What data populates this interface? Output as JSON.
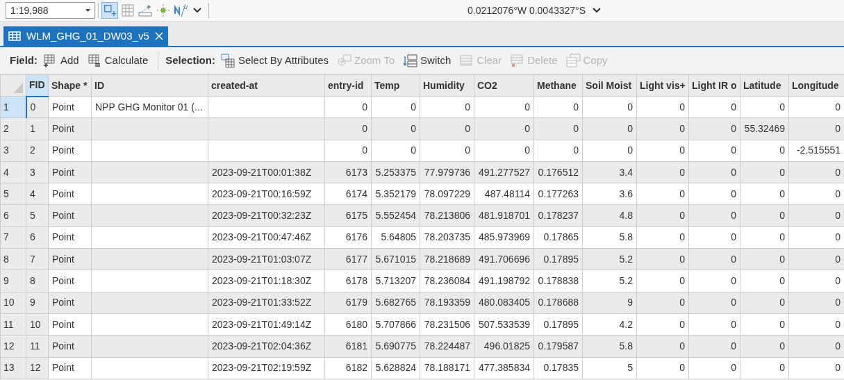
{
  "top_bar": {
    "scale": "1:19,988",
    "coordinates": "0.0212076°W 0.0043327°S"
  },
  "tab": {
    "title": "WLM_GHG_01_DW03_v5",
    "selected": true
  },
  "toolbar": {
    "field_label": "Field:",
    "field_buttons": [
      {
        "kind": "add",
        "label": "Add",
        "disabled": false
      },
      {
        "kind": "calculate",
        "label": "Calculate",
        "disabled": false
      }
    ],
    "selection_label": "Selection:",
    "selection_buttons": [
      {
        "kind": "select",
        "label": "Select By Attributes",
        "disabled": false
      },
      {
        "kind": "zoom",
        "label": "Zoom To",
        "disabled": true
      },
      {
        "kind": "switch",
        "label": "Switch",
        "disabled": false
      },
      {
        "kind": "clear",
        "label": "Clear",
        "disabled": true
      },
      {
        "kind": "delete",
        "label": "Delete",
        "disabled": true
      },
      {
        "kind": "copy",
        "label": "Copy",
        "disabled": true
      }
    ]
  },
  "table": {
    "columns": [
      {
        "label": "FID",
        "selected": true
      },
      {
        "label": "Shape *",
        "selected": false
      },
      {
        "label": "ID",
        "selected": false
      },
      {
        "label": "created-at",
        "selected": false
      },
      {
        "label": "entry-id",
        "selected": false
      },
      {
        "label": "Temp",
        "selected": false
      },
      {
        "label": "Humidity",
        "selected": false
      },
      {
        "label": "CO2",
        "selected": false
      },
      {
        "label": "Methane",
        "selected": false
      },
      {
        "label": "Soil Moist",
        "selected": false
      },
      {
        "label": "Light vis+",
        "selected": false
      },
      {
        "label": "Light IR o",
        "selected": false
      },
      {
        "label": "Latitude",
        "selected": false
      },
      {
        "label": "Longitude",
        "selected": false
      }
    ],
    "rows": [
      {
        "number": "1",
        "selected": true,
        "cells": [
          "0",
          "Point",
          "NPP GHG Monitor 01 (...",
          "",
          "0",
          "0",
          "0",
          "0",
          "0",
          "0",
          "0",
          "0",
          "0",
          "0"
        ]
      },
      {
        "number": "2",
        "selected": false,
        "cells": [
          "1",
          "Point",
          "",
          "",
          "0",
          "0",
          "0",
          "0",
          "0",
          "0",
          "0",
          "0",
          "55.32469",
          "0"
        ]
      },
      {
        "number": "3",
        "selected": false,
        "cells": [
          "2",
          "Point",
          "",
          "",
          "0",
          "0",
          "0",
          "0",
          "0",
          "0",
          "0",
          "0",
          "0",
          "-2.515551"
        ]
      },
      {
        "number": "4",
        "selected": false,
        "cells": [
          "3",
          "Point",
          "",
          "2023-09-21T00:01:38Z",
          "6173",
          "5.253375",
          "77.979736",
          "491.277527",
          "0.176512",
          "3.4",
          "0",
          "0",
          "0",
          "0"
        ]
      },
      {
        "number": "5",
        "selected": false,
        "cells": [
          "4",
          "Point",
          "",
          "2023-09-21T00:16:59Z",
          "6174",
          "5.352179",
          "78.097229",
          "487.48114",
          "0.177263",
          "3.6",
          "0",
          "0",
          "0",
          "0"
        ]
      },
      {
        "number": "6",
        "selected": false,
        "cells": [
          "5",
          "Point",
          "",
          "2023-09-21T00:32:23Z",
          "6175",
          "5.552454",
          "78.213806",
          "481.918701",
          "0.178237",
          "4.8",
          "0",
          "0",
          "0",
          "0"
        ]
      },
      {
        "number": "7",
        "selected": false,
        "cells": [
          "6",
          "Point",
          "",
          "2023-09-21T00:47:46Z",
          "6176",
          "5.64805",
          "78.203735",
          "485.973969",
          "0.17865",
          "5.8",
          "0",
          "0",
          "0",
          "0"
        ]
      },
      {
        "number": "8",
        "selected": false,
        "cells": [
          "7",
          "Point",
          "",
          "2023-09-21T01:03:07Z",
          "6177",
          "5.671015",
          "78.218689",
          "491.706696",
          "0.17895",
          "5.2",
          "0",
          "0",
          "0",
          "0"
        ]
      },
      {
        "number": "9",
        "selected": false,
        "cells": [
          "8",
          "Point",
          "",
          "2023-09-21T01:18:30Z",
          "6178",
          "5.713207",
          "78.236084",
          "491.198792",
          "0.178838",
          "5.2",
          "0",
          "0",
          "0",
          "0"
        ]
      },
      {
        "number": "10",
        "selected": false,
        "cells": [
          "9",
          "Point",
          "",
          "2023-09-21T01:33:52Z",
          "6179",
          "5.682765",
          "78.193359",
          "480.083405",
          "0.178688",
          "9",
          "0",
          "0",
          "0",
          "0"
        ]
      },
      {
        "number": "11",
        "selected": false,
        "cells": [
          "10",
          "Point",
          "",
          "2023-09-21T01:49:14Z",
          "6180",
          "5.707866",
          "78.231506",
          "507.533539",
          "0.17895",
          "4.2",
          "0",
          "0",
          "0",
          "0"
        ]
      },
      {
        "number": "12",
        "selected": false,
        "cells": [
          "11",
          "Point",
          "",
          "2023-09-21T02:04:36Z",
          "6181",
          "5.690775",
          "78.224487",
          "496.01825",
          "0.179587",
          "5.8",
          "0",
          "0",
          "0",
          "0"
        ]
      },
      {
        "number": "13",
        "selected": false,
        "cells": [
          "12",
          "Point",
          "",
          "2023-09-21T02:19:59Z",
          "6182",
          "5.628824",
          "78.188171",
          "477.385834",
          "0.17835",
          "5",
          "0",
          "0",
          "0",
          "0"
        ]
      }
    ]
  }
}
